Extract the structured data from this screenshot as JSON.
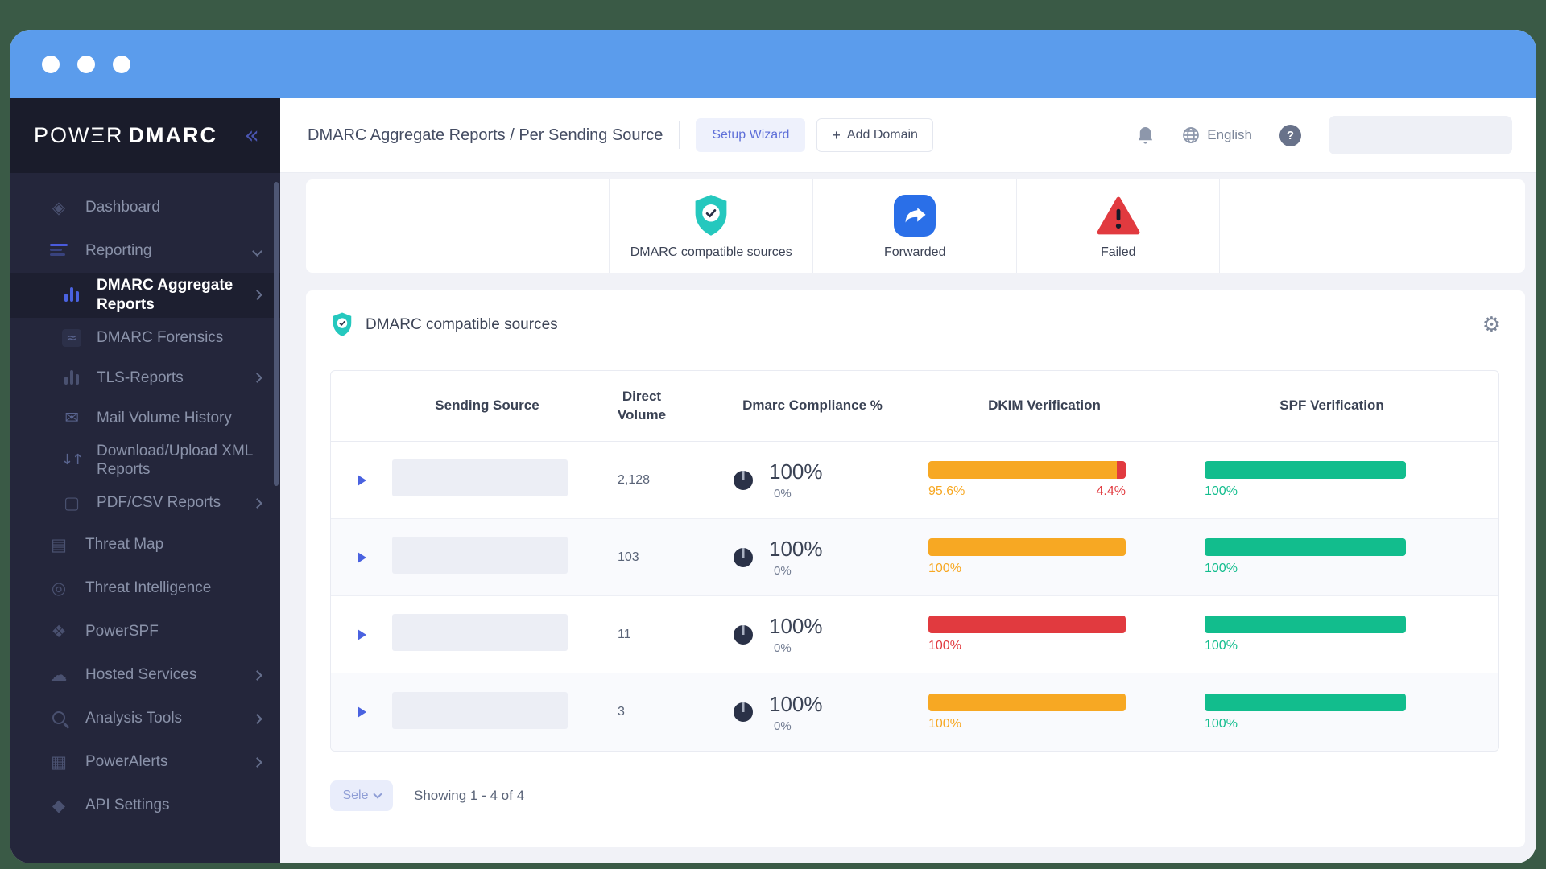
{
  "colors": {
    "titlebar_blue": "#5B9CEC",
    "sidebar_bg": "#24263B",
    "accent_indigo": "#4A5BDC",
    "teal": "#25C8BE",
    "blue": "#2A6FE8",
    "red": "#E13A3F",
    "orange": "#F7A823",
    "green": "#12BD8D",
    "donut_navy": "#2A3147"
  },
  "sidebar": {
    "logo_part1": "POWΞR",
    "logo_part2": "DMARC",
    "items": [
      {
        "label": "Dashboard"
      },
      {
        "label": "Reporting"
      },
      {
        "label": "DMARC Aggregate Reports"
      },
      {
        "label": "DMARC Forensics",
        "glyph": "≈"
      },
      {
        "label": "TLS-Reports"
      },
      {
        "label": "Mail Volume History",
        "glyph": "✉"
      },
      {
        "label": "Download/Upload XML Reports",
        "glyph": "↓↑"
      },
      {
        "label": "PDF/CSV Reports",
        "glyph": "▢"
      },
      {
        "label": "Threat Map",
        "glyph": "▤"
      },
      {
        "label": "Threat Intelligence",
        "glyph": "◎"
      },
      {
        "label": "PowerSPF",
        "glyph": "❖"
      },
      {
        "label": "Hosted Services",
        "glyph": "☁"
      },
      {
        "label": "Analysis Tools"
      },
      {
        "label": "PowerAlerts",
        "glyph": "▦"
      },
      {
        "label": "API Settings",
        "glyph": "◆"
      }
    ]
  },
  "header": {
    "breadcrumb": "DMARC Aggregate Reports / Per Sending Source",
    "setup_wizard_label": "Setup Wizard",
    "add_domain_plus": "+",
    "add_domain_label": "Add Domain",
    "language": "English",
    "help_label": "?",
    "gear_glyph": "⚙"
  },
  "stats": {
    "items": [
      {
        "label": "DMARC compatible sources",
        "icon": "shield-check-icon"
      },
      {
        "label": "Forwarded",
        "icon": "forward-arrow-icon"
      },
      {
        "label": "Failed",
        "icon": "warning-triangle-icon"
      }
    ]
  },
  "panel": {
    "title": "DMARC compatible sources"
  },
  "table": {
    "headers": {
      "sending_source": "Sending Source",
      "direct_volume": "Direct Volume",
      "dmarc_compliance": "Dmarc Compliance %",
      "dkim": "DKIM Verification",
      "spf": "SPF Verification"
    },
    "rows": [
      {
        "volume": "2,128",
        "compliance": "100%",
        "secondary": "0%",
        "dkim": {
          "segments": [
            {
              "label": "95.6%",
              "hex": "#F7A823"
            },
            {
              "label": "4.4%",
              "hex": "#E13A3F"
            }
          ]
        },
        "spf": {
          "segments": [
            {
              "label": "100%",
              "hex": "#12BD8D"
            }
          ]
        }
      },
      {
        "volume": "103",
        "compliance": "100%",
        "secondary": "0%",
        "dkim": {
          "segments": [
            {
              "label": "100%",
              "hex": "#F7A823"
            }
          ]
        },
        "spf": {
          "segments": [
            {
              "label": "100%",
              "hex": "#12BD8D"
            }
          ]
        }
      },
      {
        "volume": "11",
        "compliance": "100%",
        "secondary": "0%",
        "dkim": {
          "segments": [
            {
              "label": "100%",
              "hex": "#E13A3F"
            }
          ]
        },
        "spf": {
          "segments": [
            {
              "label": "100%",
              "hex": "#12BD8D"
            }
          ]
        }
      },
      {
        "volume": "3",
        "compliance": "100%",
        "secondary": "0%",
        "dkim": {
          "segments": [
            {
              "label": "100%",
              "hex": "#F7A823"
            }
          ]
        },
        "spf": {
          "segments": [
            {
              "label": "100%",
              "hex": "#12BD8D"
            }
          ]
        }
      }
    ]
  },
  "footer": {
    "select_label": "Sele",
    "showing": "Showing 1 - 4 of 4"
  }
}
